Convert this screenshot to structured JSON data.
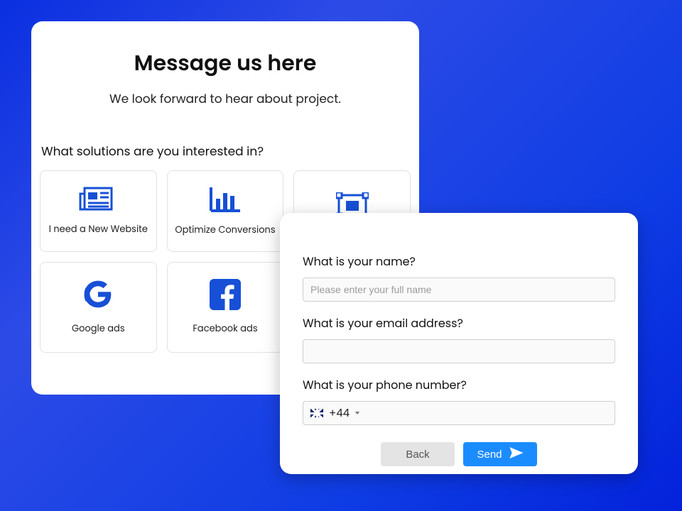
{
  "card1": {
    "title": "Message us here",
    "subtitle": "We look forward to hear about project.",
    "question": "What solutions are you interested in?",
    "tiles": [
      {
        "label": "I need a New Website"
      },
      {
        "label": "Optimize Conversions"
      },
      {
        "label": ""
      },
      {
        "label": "Google ads"
      },
      {
        "label": "Facebook ads"
      }
    ]
  },
  "card2": {
    "name_label": "What is your name?",
    "name_placeholder": "Please enter your full name",
    "email_label": "What is your email address?",
    "phone_label": "What is your phone number?",
    "dial_code": "+44",
    "back_label": "Back",
    "send_label": "Send"
  },
  "colors": {
    "accent": "#1750d6"
  }
}
